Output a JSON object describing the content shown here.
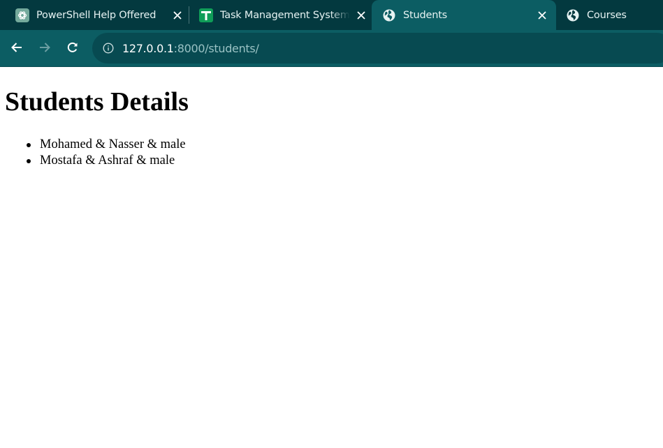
{
  "browser": {
    "tabs": [
      {
        "title": "PowerShell Help Offered",
        "favicon": "openai-icon",
        "active": false
      },
      {
        "title": "Task Management System -",
        "favicon": "sheets-icon",
        "active": false
      },
      {
        "title": "Students",
        "favicon": "globe-icon",
        "active": true
      },
      {
        "title": "Courses",
        "favicon": "globe-icon",
        "active": false
      }
    ],
    "address": {
      "host": "127.0.0.1",
      "rest": ":8000/students/"
    }
  },
  "colors": {
    "tabstrip": "#03393f",
    "toolbar": "#0c5d63",
    "omnibox": "#074a51"
  },
  "page": {
    "heading": "Students Details",
    "students": [
      "Mohamed & Nasser & male",
      "Mostafa & Ashraf & male"
    ]
  }
}
